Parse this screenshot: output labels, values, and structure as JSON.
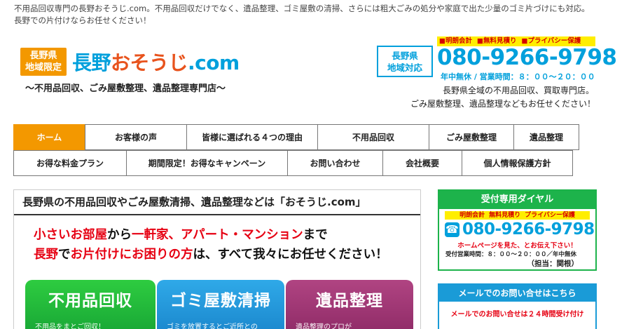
{
  "intro": {
    "line1": "不用品回収専門の長野おそうじ.com。不用品回収だけでなく、遺品整理、ゴミ屋敷の清掃、さらには粗大ごみの処分や家庭で出た少量のゴミ片づけにも対応。",
    "line2": "長野での片付けならお任せください！"
  },
  "logo": {
    "badge_line1": "長野県",
    "badge_line2": "地域限定",
    "title_main": "長野",
    "title_accent": "おそうじ",
    "title_suffix": ".com",
    "subtitle": "～不用品回収、ごみ屋敷整理、遺品整理専門店～"
  },
  "contact": {
    "region_line1": "長野県",
    "region_line2": "地域対応",
    "badges": [
      "■明朗会計",
      "■無料見積り",
      "■プライバシー保護"
    ],
    "phone": "080-9266-9798",
    "hours": "年中無休 / 営業時間：８：００～２０：００",
    "desc1": "長野県全域の不用品回収、買取専門店。",
    "desc2": "ごみ屋敷整理、遺品整理などもお任せください！"
  },
  "nav": {
    "row1": [
      "ホーム",
      "お客様の声",
      "皆様に選ばれる４つの理由",
      "不用品回収",
      "ごみ屋敷整理",
      "遺品整理"
    ],
    "row2": [
      "お得な料金プラン",
      "期間限定！お得なキャンペーン",
      "お問い合わせ",
      "会社概要",
      "個人情報保護方針"
    ]
  },
  "main": {
    "heading": "長野県の不用品回収やごみ屋敷清掃、遺品整理などは「おそうじ.com」",
    "lead1_a": "小さいお部屋",
    "lead1_b": "から",
    "lead1_c": "一軒家、アパート・マンション",
    "lead1_d": "まで",
    "lead2_a": "長野",
    "lead2_b": "で",
    "lead2_c": "お片付けにお困りの方",
    "lead2_d": "は、すべて我々にお任せください！",
    "services": [
      {
        "title": "不用品回収",
        "sub": "不用品をまとご回収！"
      },
      {
        "title": "ゴミ屋敷清掃",
        "sub": "ゴミを放置するとご近所との"
      },
      {
        "title": "遺品整理",
        "sub": "遺品整理のプロが"
      }
    ]
  },
  "side_phone": {
    "heading": "受付専用ダイヤル",
    "badges": [
      "明朗会計",
      "無料見積り",
      "プライバシー保護"
    ],
    "phone": "080-9266-9798",
    "note": "ホームページを見た、とお伝え下さい！",
    "hours": "受付営業時間：８：００～２０：００／年中無休",
    "staff": "（担当：関根）"
  },
  "side_mail": {
    "heading": "メールでのお問い合せはこちら",
    "text": "メールでのお問い合せは２４時間受け付け"
  },
  "colors": {
    "orange": "#f39800",
    "blue": "#00a0dc",
    "red": "#e60012",
    "green": "#1db34b"
  }
}
